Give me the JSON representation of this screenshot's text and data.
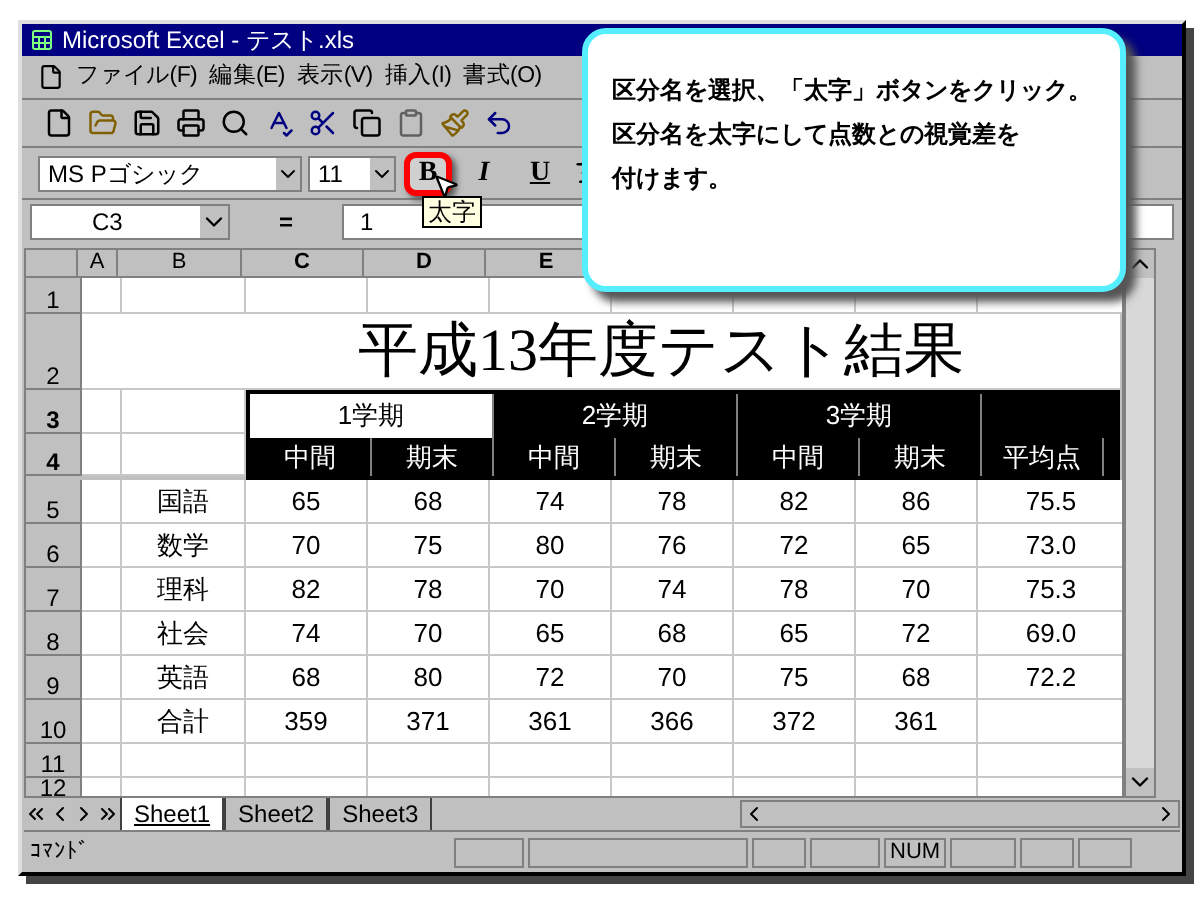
{
  "window": {
    "title": "Microsoft Excel - テスト.xls"
  },
  "menus": [
    "ファイル(F)",
    "編集(E)",
    "表示(V)",
    "挿入(I)",
    "書式(O)"
  ],
  "format_bar": {
    "font": "MS Pゴシック",
    "size": "11",
    "buttons": [
      {
        "label": "B",
        "highlighted": true
      },
      {
        "label": "I",
        "highlighted": false
      },
      {
        "label": "U",
        "highlighted": false
      }
    ],
    "tooltip": "太字"
  },
  "formula_bar": {
    "name_box": "C3",
    "equals": "=",
    "value": "1"
  },
  "columns": [
    {
      "label": "A",
      "selected": false
    },
    {
      "label": "B",
      "selected": false
    },
    {
      "label": "C",
      "selected": true
    },
    {
      "label": "D",
      "selected": true
    },
    {
      "label": "E",
      "selected": true
    }
  ],
  "row_numbers": [
    {
      "label": "1",
      "selected": false
    },
    {
      "label": "2",
      "selected": false
    },
    {
      "label": "3",
      "selected": true
    },
    {
      "label": "4",
      "selected": true
    },
    {
      "label": "5",
      "selected": false
    },
    {
      "label": "6",
      "selected": false
    },
    {
      "label": "7",
      "selected": false
    },
    {
      "label": "8",
      "selected": false
    },
    {
      "label": "9",
      "selected": false
    },
    {
      "label": "10",
      "selected": false
    },
    {
      "label": "11",
      "selected": false
    },
    {
      "label": "12",
      "selected": false
    }
  ],
  "sheet_title": "平成13年度テスト結果",
  "terms": [
    {
      "label": "1学期",
      "selected": true
    },
    {
      "label": "2学期",
      "selected": false
    },
    {
      "label": "3学期",
      "selected": false
    }
  ],
  "subheaders": [
    "中間",
    "期末",
    "中間",
    "期末",
    "中間",
    "期末",
    "平均点"
  ],
  "rows": [
    {
      "label": "国語",
      "values": [
        "65",
        "68",
        "74",
        "78",
        "82",
        "86",
        "75.5"
      ]
    },
    {
      "label": "数学",
      "values": [
        "70",
        "75",
        "80",
        "76",
        "72",
        "65",
        "73.0"
      ]
    },
    {
      "label": "理科",
      "values": [
        "82",
        "78",
        "70",
        "74",
        "78",
        "70",
        "75.3"
      ]
    },
    {
      "label": "社会",
      "values": [
        "74",
        "70",
        "65",
        "68",
        "65",
        "72",
        "69.0"
      ]
    },
    {
      "label": "英語",
      "values": [
        "68",
        "80",
        "72",
        "70",
        "75",
        "68",
        "72.2"
      ]
    },
    {
      "label": "合計",
      "values": [
        "359",
        "371",
        "361",
        "366",
        "372",
        "361"
      ]
    }
  ],
  "sheet_tabs": [
    {
      "label": "Sheet1",
      "selected": true
    },
    {
      "label": "Sheet2",
      "selected": false
    },
    {
      "label": "Sheet3",
      "selected": false
    }
  ],
  "status_bar": {
    "mode": "ｺﾏﾝﾄﾞ",
    "num": "NUM"
  },
  "callout": {
    "lines": [
      "区分名を選択、「太字」ボタンをクリック。",
      "区分名を太字にして点数との視覚差を",
      "付けます。"
    ]
  }
}
